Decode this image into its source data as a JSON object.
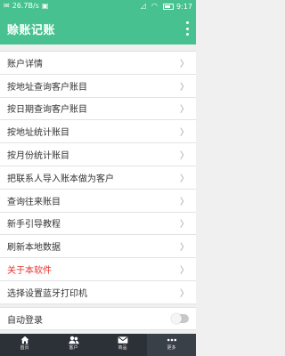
{
  "status_bar": {
    "left_text": "26.7B/s",
    "time": "9:17"
  },
  "app_bar": {
    "title": "赊账记账"
  },
  "menu": {
    "items": [
      {
        "label": "账户详情"
      },
      {
        "label": "按地址查询客户账目"
      },
      {
        "label": "按日期查询客户账目"
      },
      {
        "label": "按地址统计账目"
      },
      {
        "label": "按月份统计账目"
      },
      {
        "label": "把联系人导入账本做为客户"
      },
      {
        "label": "查询往来账目"
      },
      {
        "label": "新手引导教程"
      },
      {
        "label": "刷新本地数据"
      },
      {
        "label": "关于本软件",
        "color": "#e8312c"
      },
      {
        "label": "选择设置蓝牙打印机"
      }
    ],
    "chevron": "〉"
  },
  "settings": {
    "auto_login_label": "自动登录",
    "auto_login_enabled": false
  },
  "bottom_nav": {
    "items": [
      {
        "label": "首页",
        "icon": "home-icon"
      },
      {
        "label": "客户",
        "icon": "people-icon"
      },
      {
        "label": "商品",
        "icon": "mail-icon"
      },
      {
        "label": "更多",
        "icon": "more-icon",
        "active": true
      }
    ]
  },
  "colors": {
    "primary": "#47c18f",
    "nav_bg": "#2c3138",
    "danger": "#e8312c"
  }
}
